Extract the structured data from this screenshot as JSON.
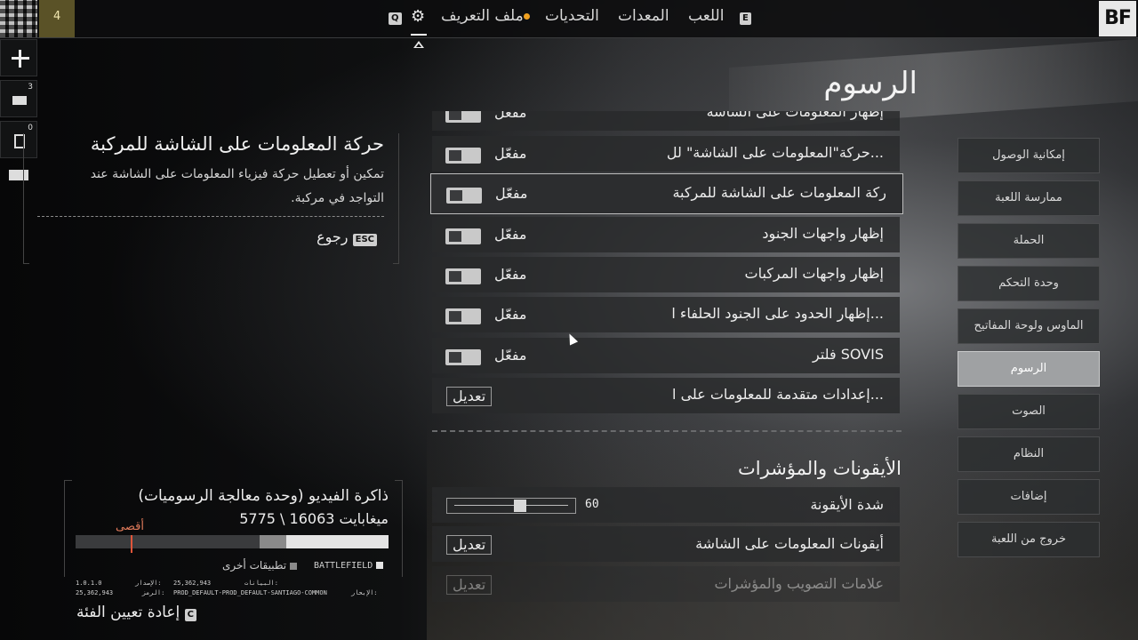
{
  "topbar": {
    "rank": "4",
    "key_q": "Q",
    "key_e": "E",
    "nav_profile": "ملف التعريف",
    "nav_challenges": "التحديات",
    "nav_equipment": "المعدات",
    "nav_play": "اللعب",
    "logo": "BF",
    "notification_dot_color": "#f0a020"
  },
  "rail": {
    "mail_count": "3",
    "squad_count": "0"
  },
  "page": {
    "title": "الرسوم"
  },
  "side_menu": [
    {
      "label": "إمكانية الوصول"
    },
    {
      "label": "ممارسة اللعبة"
    },
    {
      "label": "الحملة"
    },
    {
      "label": "وحدة التحكم"
    },
    {
      "label": "الماوس ولوحة المفاتيح"
    },
    {
      "label": "الرسوم",
      "active": true
    },
    {
      "label": "الصوت"
    },
    {
      "label": "النظام"
    },
    {
      "label": "إضافات"
    },
    {
      "label": "خروج من اللعبة"
    }
  ],
  "settings": [
    {
      "label": "إظهار المعلومات على الشاشة",
      "value": "مفعّل"
    },
    {
      "label": "حركة\"المعلومات على الشاشة\" لل...",
      "value": "مفعّل"
    },
    {
      "label": "ركة المعلومات على الشاشة للمركبة",
      "value": "مفعّل",
      "selected": true
    },
    {
      "label": "إظهار واجهات الجنود",
      "value": "مفعّل"
    },
    {
      "label": "إظهار واجهات المركبات",
      "value": "مفعّل"
    },
    {
      "label": "إظهار الحدود على الجنود الحلفاء ا...",
      "value": "مفعّل"
    },
    {
      "label": "فلتر SOVIS",
      "value": "مفعّل"
    },
    {
      "label": "إعدادات متقدمة للمعلومات على ا...",
      "button": "تعديل"
    }
  ],
  "icons_section": {
    "title": "الأيقونات والمؤشرات",
    "icon_intensity_label": "شدة الأيقونة",
    "icon_intensity_value": "60",
    "icon_intensity_fraction": 0.58,
    "hud_icons_label": "أيقونات المعلومات على الشاشة",
    "hud_icons_button": "تعديل",
    "crosshair_label": "علامات التصويب والمؤشرات",
    "crosshair_button": "تعديل"
  },
  "description": {
    "title": "حركة المعلومات على الشاشة للمركبة",
    "text": "تمكين أو تعطيل حركة فيزياء المعلومات على الشاشة عند التواجد في مركبة.",
    "back_key": "ESC",
    "back_label": "رجوع"
  },
  "memory": {
    "title": "ذاكرة الفيديو (وحدة معالجة الرسوميات)",
    "values": "5775 \\ 16063 ميغابايت",
    "max_label": "أقصى",
    "legend_bf": "BATTLEFIELD",
    "legend_other": "تطبيقات أخرى",
    "version_label": "الإصدار:",
    "version_value": "1.0.1.0",
    "code_label": "الرمز:",
    "code_value": "25,362,943",
    "data_label": "البيانات:",
    "data_value": "25,362,943",
    "sail_label": "الإبحار:",
    "sail_value": "PROD_DEFAULT-PROD_DEFAULT-SANTIAGO-COMMON",
    "reset_key": "C",
    "reset_label": "إعادة تعيين الفئة"
  }
}
